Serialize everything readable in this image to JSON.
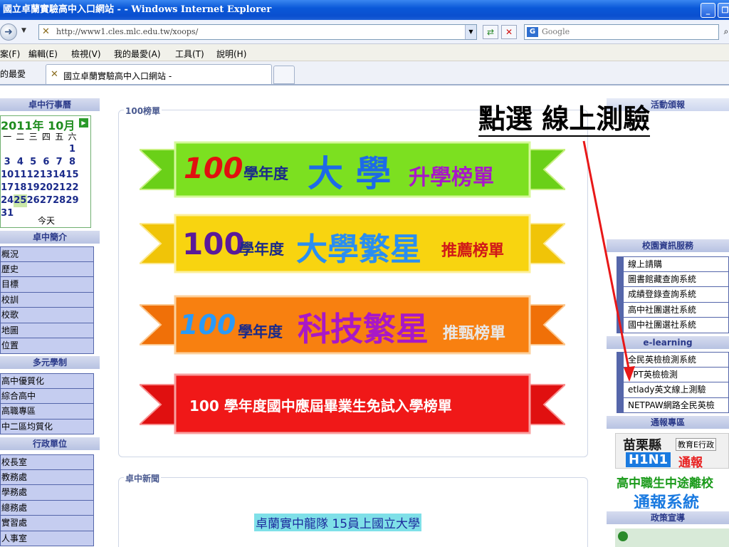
{
  "window": {
    "title": "國立卓蘭實驗高中入口網站 - - Windows Internet Explorer",
    "minimize": "_",
    "restore": "❐"
  },
  "addressbar": {
    "url": "http://www1.cles.mlc.edu.tw/xoops/",
    "search_placeholder": "Google"
  },
  "menu": [
    "案(F)",
    "編輯(E)",
    "檢視(V)",
    "我的最愛(A)",
    "工具(T)",
    "說明(H)"
  ],
  "tabs": {
    "favorites_label": "的最愛",
    "active_tab": "國立卓蘭實驗高中入口網站 -"
  },
  "left": {
    "calendar_head": "卓中行事曆",
    "calendar": {
      "title": "2011年 10月",
      "weekdays": [
        "一",
        "二",
        "三",
        "四",
        "五",
        "六"
      ],
      "rows": [
        [
          "",
          "",
          "",
          "",
          "",
          "1"
        ],
        [
          "3",
          "4",
          "5",
          "6",
          "7",
          "8"
        ],
        [
          "10",
          "11",
          "12",
          "13",
          "14",
          "15"
        ],
        [
          "17",
          "18",
          "19",
          "20",
          "21",
          "22"
        ],
        [
          "24",
          "25",
          "26",
          "27",
          "28",
          "29"
        ],
        [
          "31",
          "",
          "",
          "",
          "",
          ""
        ]
      ],
      "today_label": "今天"
    },
    "intro_head": "卓中簡介",
    "intro_items": [
      "概況",
      "歷史",
      "目標",
      "校訓",
      "校歌",
      "地圖",
      "位置"
    ],
    "multi_head": "多元學制",
    "multi_items": [
      "高中優質化",
      "綜合高中",
      "高職專區",
      "中二區均質化"
    ],
    "admin_head": "行政單位",
    "admin_items": [
      "校長室",
      "教務處",
      "學務處",
      "總務處",
      "實習處",
      "人事室"
    ]
  },
  "center": {
    "box_title": "100榜單",
    "banners": [
      {
        "part1": "100",
        "part2": "學年度",
        "part3": "大 學",
        "part4": "升學榜單",
        "color": "#7ce020"
      },
      {
        "part1": "100",
        "part2": "學年度",
        "part3": "大學繁星",
        "part4": "推薦榜單",
        "color": "#f8d410"
      },
      {
        "part1": "100",
        "part2": "學年度",
        "part3": "科技繁星",
        "part4": "推甄榜單",
        "color": "#f88010"
      },
      {
        "text": "100 學年度國中應屆畢業生免試入學榜單",
        "color": "#f01818"
      }
    ],
    "news_title": "卓中新聞",
    "news_item": "卓蘭實中龍隊 15員上國立大學"
  },
  "right": {
    "activity_head": "活動頒報",
    "campus_head": "校園資訊服務",
    "campus_items": [
      "線上請購",
      "圖書館藏查詢系統",
      "成績登錄查詢系統",
      "高中社團選社系統",
      "國中社團選社系統"
    ],
    "elearning_head": "e-learning",
    "elearning_items": [
      "全民英檢檢測系統",
      "TPT英檢檢測",
      "etlady英文線上測驗",
      "NETPAW網路全民英檢"
    ],
    "report_head": "通報專區",
    "promo1": {
      "line1": "苗栗縣",
      "line1b": "教育E行政",
      "line2": "H1N1",
      "line2b": "通報"
    },
    "promo2": {
      "line1": "高中職生中途離校",
      "line2": "通報系統"
    },
    "policy_head": "政策宣導"
  },
  "annotation": "點選 線上測驗"
}
